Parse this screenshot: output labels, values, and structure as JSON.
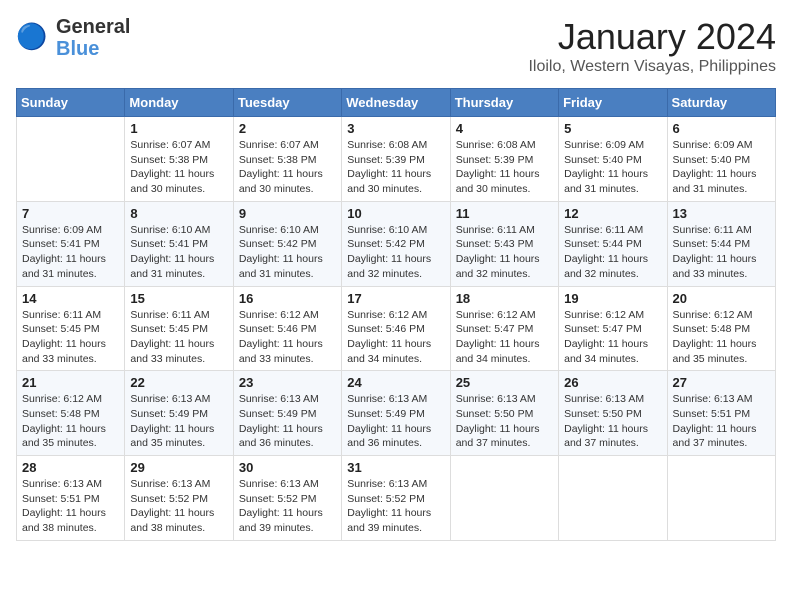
{
  "header": {
    "logo": {
      "line1": "General",
      "line2": "Blue"
    },
    "title": "January 2024",
    "subtitle": "Iloilo, Western Visayas, Philippines"
  },
  "calendar": {
    "days_of_week": [
      "Sunday",
      "Monday",
      "Tuesday",
      "Wednesday",
      "Thursday",
      "Friday",
      "Saturday"
    ],
    "weeks": [
      [
        {
          "day": "",
          "info": ""
        },
        {
          "day": "1",
          "sunrise": "Sunrise: 6:07 AM",
          "sunset": "Sunset: 5:38 PM",
          "daylight": "Daylight: 11 hours and 30 minutes."
        },
        {
          "day": "2",
          "sunrise": "Sunrise: 6:07 AM",
          "sunset": "Sunset: 5:38 PM",
          "daylight": "Daylight: 11 hours and 30 minutes."
        },
        {
          "day": "3",
          "sunrise": "Sunrise: 6:08 AM",
          "sunset": "Sunset: 5:39 PM",
          "daylight": "Daylight: 11 hours and 30 minutes."
        },
        {
          "day": "4",
          "sunrise": "Sunrise: 6:08 AM",
          "sunset": "Sunset: 5:39 PM",
          "daylight": "Daylight: 11 hours and 30 minutes."
        },
        {
          "day": "5",
          "sunrise": "Sunrise: 6:09 AM",
          "sunset": "Sunset: 5:40 PM",
          "daylight": "Daylight: 11 hours and 31 minutes."
        },
        {
          "day": "6",
          "sunrise": "Sunrise: 6:09 AM",
          "sunset": "Sunset: 5:40 PM",
          "daylight": "Daylight: 11 hours and 31 minutes."
        }
      ],
      [
        {
          "day": "7",
          "sunrise": "Sunrise: 6:09 AM",
          "sunset": "Sunset: 5:41 PM",
          "daylight": "Daylight: 11 hours and 31 minutes."
        },
        {
          "day": "8",
          "sunrise": "Sunrise: 6:10 AM",
          "sunset": "Sunset: 5:41 PM",
          "daylight": "Daylight: 11 hours and 31 minutes."
        },
        {
          "day": "9",
          "sunrise": "Sunrise: 6:10 AM",
          "sunset": "Sunset: 5:42 PM",
          "daylight": "Daylight: 11 hours and 31 minutes."
        },
        {
          "day": "10",
          "sunrise": "Sunrise: 6:10 AM",
          "sunset": "Sunset: 5:42 PM",
          "daylight": "Daylight: 11 hours and 32 minutes."
        },
        {
          "day": "11",
          "sunrise": "Sunrise: 6:11 AM",
          "sunset": "Sunset: 5:43 PM",
          "daylight": "Daylight: 11 hours and 32 minutes."
        },
        {
          "day": "12",
          "sunrise": "Sunrise: 6:11 AM",
          "sunset": "Sunset: 5:44 PM",
          "daylight": "Daylight: 11 hours and 32 minutes."
        },
        {
          "day": "13",
          "sunrise": "Sunrise: 6:11 AM",
          "sunset": "Sunset: 5:44 PM",
          "daylight": "Daylight: 11 hours and 33 minutes."
        }
      ],
      [
        {
          "day": "14",
          "sunrise": "Sunrise: 6:11 AM",
          "sunset": "Sunset: 5:45 PM",
          "daylight": "Daylight: 11 hours and 33 minutes."
        },
        {
          "day": "15",
          "sunrise": "Sunrise: 6:11 AM",
          "sunset": "Sunset: 5:45 PM",
          "daylight": "Daylight: 11 hours and 33 minutes."
        },
        {
          "day": "16",
          "sunrise": "Sunrise: 6:12 AM",
          "sunset": "Sunset: 5:46 PM",
          "daylight": "Daylight: 11 hours and 33 minutes."
        },
        {
          "day": "17",
          "sunrise": "Sunrise: 6:12 AM",
          "sunset": "Sunset: 5:46 PM",
          "daylight": "Daylight: 11 hours and 34 minutes."
        },
        {
          "day": "18",
          "sunrise": "Sunrise: 6:12 AM",
          "sunset": "Sunset: 5:47 PM",
          "daylight": "Daylight: 11 hours and 34 minutes."
        },
        {
          "day": "19",
          "sunrise": "Sunrise: 6:12 AM",
          "sunset": "Sunset: 5:47 PM",
          "daylight": "Daylight: 11 hours and 34 minutes."
        },
        {
          "day": "20",
          "sunrise": "Sunrise: 6:12 AM",
          "sunset": "Sunset: 5:48 PM",
          "daylight": "Daylight: 11 hours and 35 minutes."
        }
      ],
      [
        {
          "day": "21",
          "sunrise": "Sunrise: 6:12 AM",
          "sunset": "Sunset: 5:48 PM",
          "daylight": "Daylight: 11 hours and 35 minutes."
        },
        {
          "day": "22",
          "sunrise": "Sunrise: 6:13 AM",
          "sunset": "Sunset: 5:49 PM",
          "daylight": "Daylight: 11 hours and 35 minutes."
        },
        {
          "day": "23",
          "sunrise": "Sunrise: 6:13 AM",
          "sunset": "Sunset: 5:49 PM",
          "daylight": "Daylight: 11 hours and 36 minutes."
        },
        {
          "day": "24",
          "sunrise": "Sunrise: 6:13 AM",
          "sunset": "Sunset: 5:49 PM",
          "daylight": "Daylight: 11 hours and 36 minutes."
        },
        {
          "day": "25",
          "sunrise": "Sunrise: 6:13 AM",
          "sunset": "Sunset: 5:50 PM",
          "daylight": "Daylight: 11 hours and 37 minutes."
        },
        {
          "day": "26",
          "sunrise": "Sunrise: 6:13 AM",
          "sunset": "Sunset: 5:50 PM",
          "daylight": "Daylight: 11 hours and 37 minutes."
        },
        {
          "day": "27",
          "sunrise": "Sunrise: 6:13 AM",
          "sunset": "Sunset: 5:51 PM",
          "daylight": "Daylight: 11 hours and 37 minutes."
        }
      ],
      [
        {
          "day": "28",
          "sunrise": "Sunrise: 6:13 AM",
          "sunset": "Sunset: 5:51 PM",
          "daylight": "Daylight: 11 hours and 38 minutes."
        },
        {
          "day": "29",
          "sunrise": "Sunrise: 6:13 AM",
          "sunset": "Sunset: 5:52 PM",
          "daylight": "Daylight: 11 hours and 38 minutes."
        },
        {
          "day": "30",
          "sunrise": "Sunrise: 6:13 AM",
          "sunset": "Sunset: 5:52 PM",
          "daylight": "Daylight: 11 hours and 39 minutes."
        },
        {
          "day": "31",
          "sunrise": "Sunrise: 6:13 AM",
          "sunset": "Sunset: 5:52 PM",
          "daylight": "Daylight: 11 hours and 39 minutes."
        },
        {
          "day": "",
          "info": ""
        },
        {
          "day": "",
          "info": ""
        },
        {
          "day": "",
          "info": ""
        }
      ]
    ]
  }
}
